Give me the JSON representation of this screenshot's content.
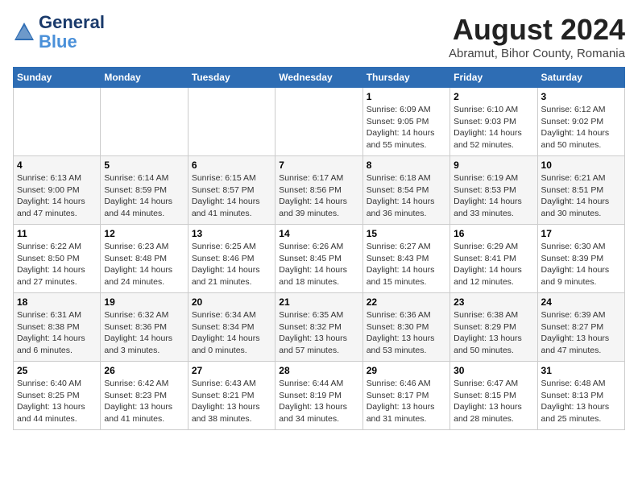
{
  "header": {
    "logo_line1": "General",
    "logo_line2": "Blue",
    "title": "August 2024",
    "subtitle": "Abramut, Bihor County, Romania"
  },
  "weekdays": [
    "Sunday",
    "Monday",
    "Tuesday",
    "Wednesday",
    "Thursday",
    "Friday",
    "Saturday"
  ],
  "weeks": [
    [
      {
        "day": "",
        "info": ""
      },
      {
        "day": "",
        "info": ""
      },
      {
        "day": "",
        "info": ""
      },
      {
        "day": "",
        "info": ""
      },
      {
        "day": "1",
        "info": "Sunrise: 6:09 AM\nSunset: 9:05 PM\nDaylight: 14 hours\nand 55 minutes."
      },
      {
        "day": "2",
        "info": "Sunrise: 6:10 AM\nSunset: 9:03 PM\nDaylight: 14 hours\nand 52 minutes."
      },
      {
        "day": "3",
        "info": "Sunrise: 6:12 AM\nSunset: 9:02 PM\nDaylight: 14 hours\nand 50 minutes."
      }
    ],
    [
      {
        "day": "4",
        "info": "Sunrise: 6:13 AM\nSunset: 9:00 PM\nDaylight: 14 hours\nand 47 minutes."
      },
      {
        "day": "5",
        "info": "Sunrise: 6:14 AM\nSunset: 8:59 PM\nDaylight: 14 hours\nand 44 minutes."
      },
      {
        "day": "6",
        "info": "Sunrise: 6:15 AM\nSunset: 8:57 PM\nDaylight: 14 hours\nand 41 minutes."
      },
      {
        "day": "7",
        "info": "Sunrise: 6:17 AM\nSunset: 8:56 PM\nDaylight: 14 hours\nand 39 minutes."
      },
      {
        "day": "8",
        "info": "Sunrise: 6:18 AM\nSunset: 8:54 PM\nDaylight: 14 hours\nand 36 minutes."
      },
      {
        "day": "9",
        "info": "Sunrise: 6:19 AM\nSunset: 8:53 PM\nDaylight: 14 hours\nand 33 minutes."
      },
      {
        "day": "10",
        "info": "Sunrise: 6:21 AM\nSunset: 8:51 PM\nDaylight: 14 hours\nand 30 minutes."
      }
    ],
    [
      {
        "day": "11",
        "info": "Sunrise: 6:22 AM\nSunset: 8:50 PM\nDaylight: 14 hours\nand 27 minutes."
      },
      {
        "day": "12",
        "info": "Sunrise: 6:23 AM\nSunset: 8:48 PM\nDaylight: 14 hours\nand 24 minutes."
      },
      {
        "day": "13",
        "info": "Sunrise: 6:25 AM\nSunset: 8:46 PM\nDaylight: 14 hours\nand 21 minutes."
      },
      {
        "day": "14",
        "info": "Sunrise: 6:26 AM\nSunset: 8:45 PM\nDaylight: 14 hours\nand 18 minutes."
      },
      {
        "day": "15",
        "info": "Sunrise: 6:27 AM\nSunset: 8:43 PM\nDaylight: 14 hours\nand 15 minutes."
      },
      {
        "day": "16",
        "info": "Sunrise: 6:29 AM\nSunset: 8:41 PM\nDaylight: 14 hours\nand 12 minutes."
      },
      {
        "day": "17",
        "info": "Sunrise: 6:30 AM\nSunset: 8:39 PM\nDaylight: 14 hours\nand 9 minutes."
      }
    ],
    [
      {
        "day": "18",
        "info": "Sunrise: 6:31 AM\nSunset: 8:38 PM\nDaylight: 14 hours\nand 6 minutes."
      },
      {
        "day": "19",
        "info": "Sunrise: 6:32 AM\nSunset: 8:36 PM\nDaylight: 14 hours\nand 3 minutes."
      },
      {
        "day": "20",
        "info": "Sunrise: 6:34 AM\nSunset: 8:34 PM\nDaylight: 14 hours\nand 0 minutes."
      },
      {
        "day": "21",
        "info": "Sunrise: 6:35 AM\nSunset: 8:32 PM\nDaylight: 13 hours\nand 57 minutes."
      },
      {
        "day": "22",
        "info": "Sunrise: 6:36 AM\nSunset: 8:30 PM\nDaylight: 13 hours\nand 53 minutes."
      },
      {
        "day": "23",
        "info": "Sunrise: 6:38 AM\nSunset: 8:29 PM\nDaylight: 13 hours\nand 50 minutes."
      },
      {
        "day": "24",
        "info": "Sunrise: 6:39 AM\nSunset: 8:27 PM\nDaylight: 13 hours\nand 47 minutes."
      }
    ],
    [
      {
        "day": "25",
        "info": "Sunrise: 6:40 AM\nSunset: 8:25 PM\nDaylight: 13 hours\nand 44 minutes."
      },
      {
        "day": "26",
        "info": "Sunrise: 6:42 AM\nSunset: 8:23 PM\nDaylight: 13 hours\nand 41 minutes."
      },
      {
        "day": "27",
        "info": "Sunrise: 6:43 AM\nSunset: 8:21 PM\nDaylight: 13 hours\nand 38 minutes."
      },
      {
        "day": "28",
        "info": "Sunrise: 6:44 AM\nSunset: 8:19 PM\nDaylight: 13 hours\nand 34 minutes."
      },
      {
        "day": "29",
        "info": "Sunrise: 6:46 AM\nSunset: 8:17 PM\nDaylight: 13 hours\nand 31 minutes."
      },
      {
        "day": "30",
        "info": "Sunrise: 6:47 AM\nSunset: 8:15 PM\nDaylight: 13 hours\nand 28 minutes."
      },
      {
        "day": "31",
        "info": "Sunrise: 6:48 AM\nSunset: 8:13 PM\nDaylight: 13 hours\nand 25 minutes."
      }
    ]
  ]
}
